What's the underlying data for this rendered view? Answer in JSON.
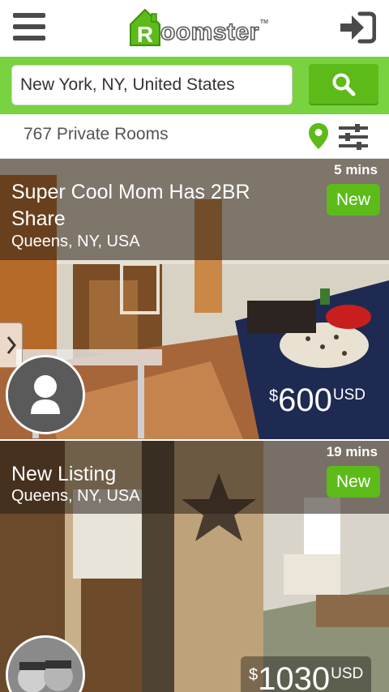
{
  "header": {
    "menu_icon": "hamburger-menu-icon",
    "logo": "Roomster",
    "login_icon": "sign-in-icon"
  },
  "search": {
    "value": "New York, NY, United States",
    "button_icon": "search-icon"
  },
  "filters": {
    "result_count": "767 Private Rooms",
    "map_icon": "map-pin-icon",
    "filter_icon": "sliders-icon"
  },
  "colors": {
    "brand_green": "#79d23f",
    "button_green": "#5cbb19"
  },
  "listings": [
    {
      "title": "Super Cool Mom Has 2BR Share",
      "location": "Queens, NY, USA",
      "time_ago": "5 mins",
      "badge": "New",
      "price_symbol": "$",
      "price": "600",
      "currency": "USD"
    },
    {
      "title": "New Listing",
      "location": "Queens, NY, USA",
      "time_ago": "19 mins",
      "badge": "New",
      "price_symbol": "$",
      "price": "1030",
      "currency": "USD"
    }
  ]
}
